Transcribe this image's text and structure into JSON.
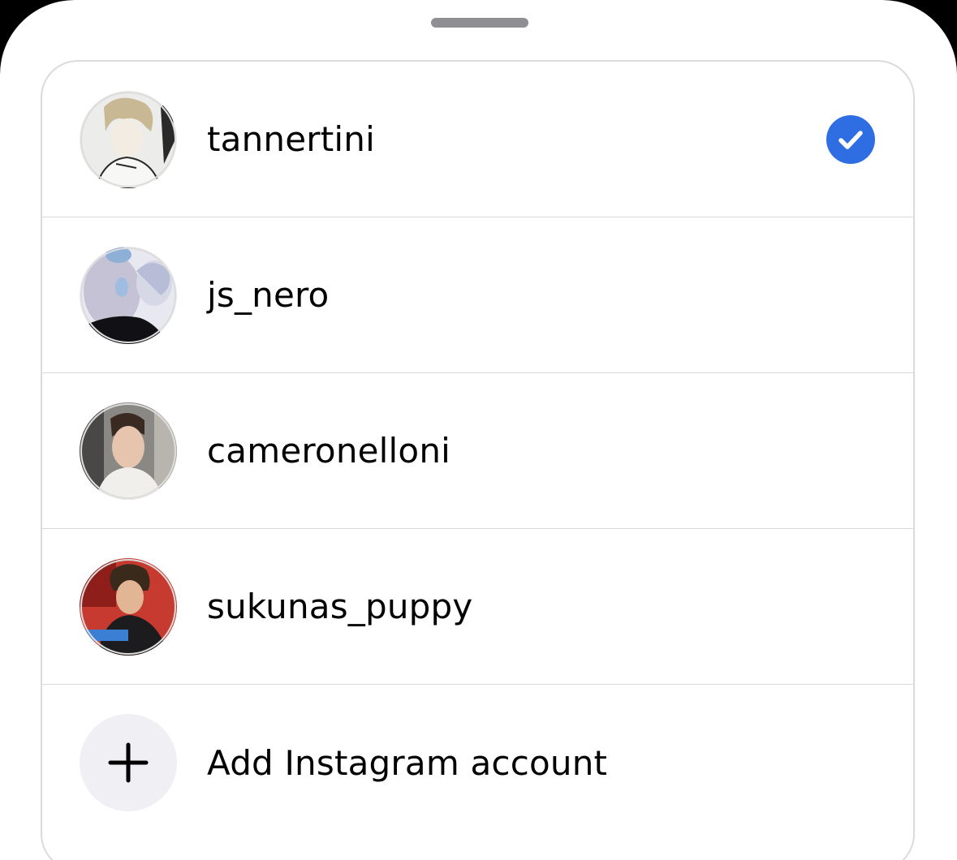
{
  "accounts": [
    {
      "username": "tannertini",
      "selected": true
    },
    {
      "username": "js_nero",
      "selected": false
    },
    {
      "username": "cameronelloni",
      "selected": false
    },
    {
      "username": "sukunas_puppy",
      "selected": false
    }
  ],
  "add_account": {
    "label": "Add Instagram account",
    "icon": "plus-icon"
  },
  "colors": {
    "accent": "#2f6ee2",
    "divider": "#dbdbdb",
    "add_bg": "#efeff4"
  }
}
